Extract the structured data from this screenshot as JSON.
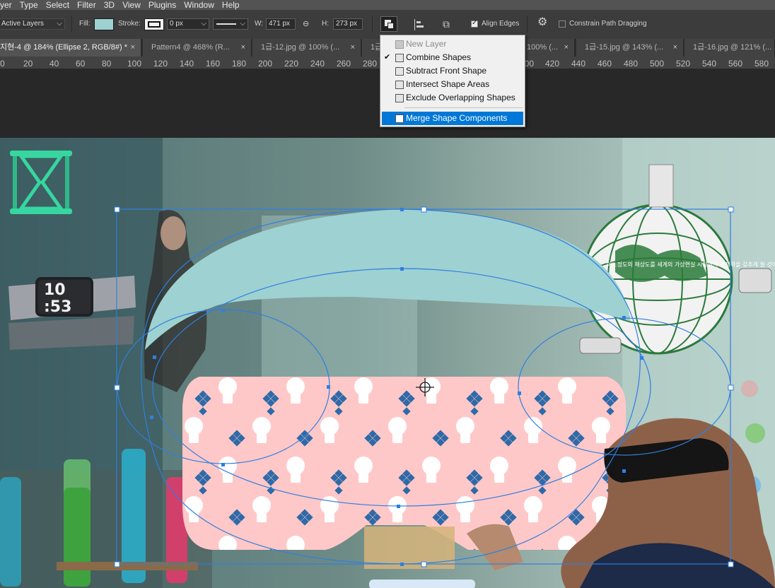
{
  "menubar": {
    "items": [
      "yer",
      "Type",
      "Select",
      "Filter",
      "3D",
      "View",
      "Plugins",
      "Window",
      "Help"
    ]
  },
  "options": {
    "layers_select": "Active Layers",
    "fill_label": "Fill:",
    "stroke_label": "Stroke:",
    "stroke_width": "0 px",
    "w_label": "W:",
    "w_value": "471 px",
    "h_label": "H:",
    "h_value": "273 px",
    "align_edges_label": "Align Edges",
    "align_edges_checked": true,
    "constrain_label": "Constrain Path Dragging",
    "constrain_checked": false,
    "fill_color": "#9ed1d2"
  },
  "tabs": [
    {
      "label": "지현-4 @ 184% (Ellipse 2, RGB/8#) *",
      "active": true
    },
    {
      "label": "Pattern4 @ 468% (R...",
      "active": false
    },
    {
      "label": "1급-12.jpg @ 100% (...",
      "active": false
    },
    {
      "label": "1급",
      "active": false
    },
    {
      "label": "100% (...",
      "active": false
    },
    {
      "label": "1급-15.jpg @ 143% (...",
      "active": false
    },
    {
      "label": "1급-16.jpg @ 121% (...",
      "active": false
    }
  ],
  "ruler": {
    "ticks": [
      "0",
      "20",
      "40",
      "60",
      "80",
      "100",
      "120",
      "140",
      "160",
      "180",
      "200",
      "220",
      "240",
      "260",
      "280",
      "400",
      "420",
      "440",
      "460",
      "480",
      "500",
      "520",
      "540",
      "560",
      "580"
    ]
  },
  "path_ops_menu": {
    "items": [
      {
        "label": "New Layer",
        "disabled": true,
        "checked": false,
        "selected": false
      },
      {
        "label": "Combine Shapes",
        "disabled": false,
        "checked": true,
        "selected": false
      },
      {
        "label": "Subtract Front Shape",
        "disabled": false,
        "checked": false,
        "selected": false
      },
      {
        "label": "Intersect Shape Areas",
        "disabled": false,
        "checked": false,
        "selected": false
      },
      {
        "label": "Exclude Overlapping Shapes",
        "disabled": false,
        "checked": false,
        "selected": false
      },
      {
        "label": "Merge Shape Components",
        "disabled": false,
        "checked": false,
        "selected": true
      }
    ]
  },
  "canvas": {
    "watch_time_top": "10",
    "watch_time_bottom": ":53",
    "globe_text": "어느정도의 해상도를 세계의 가상현실 시장에서 경쟁력을 갖추게 될 것이다"
  },
  "colors": {
    "app_bg": "#282828",
    "menubar": "#535353",
    "optbar": "#3c3c3c",
    "accent": "#0078d7",
    "shape_fill": "#9ed1d2",
    "headset_fill": "#ffc8c8",
    "pattern_diamond": "#2e6aa8",
    "path_line": "#2f7fe0"
  }
}
